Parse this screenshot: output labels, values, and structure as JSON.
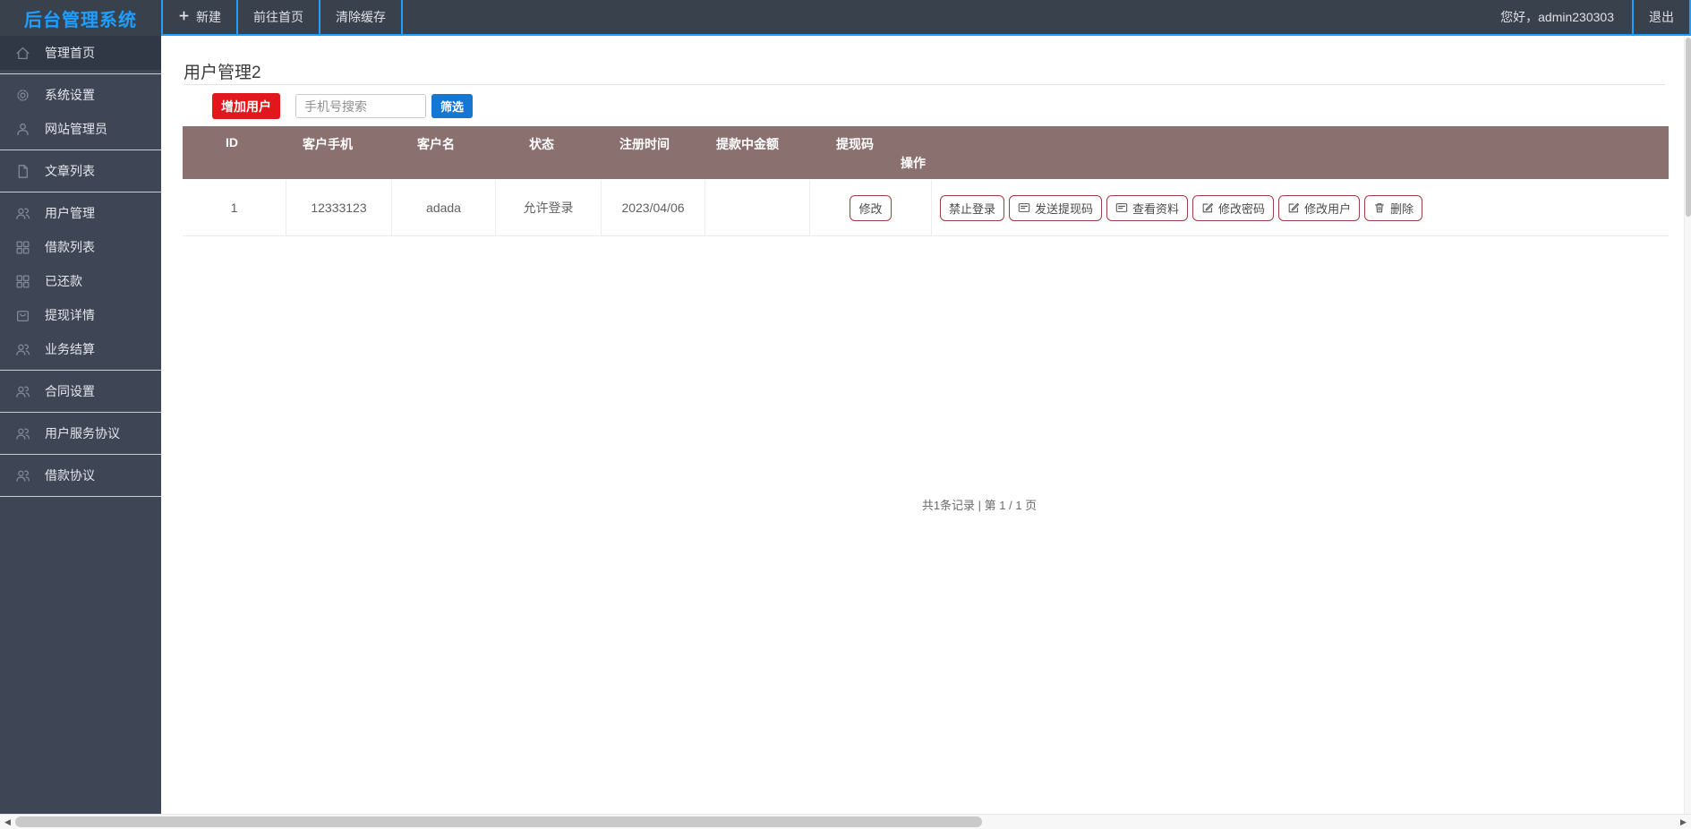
{
  "app_title": "后台管理系统",
  "topbar": {
    "nav": [
      {
        "label": "新建",
        "icon": "plus-icon"
      },
      {
        "label": "前往首页",
        "icon": ""
      },
      {
        "label": "清除缓存",
        "icon": ""
      }
    ],
    "greeting": "您好，admin230303",
    "logout": "退出"
  },
  "sidebar": {
    "items": [
      {
        "label": "管理首页",
        "icon": "home-icon",
        "active": true
      },
      {
        "label": "系统设置",
        "icon": "gear-icon",
        "active": false
      },
      {
        "label": "网站管理员",
        "icon": "user-icon",
        "active": false
      },
      {
        "label": "文章列表",
        "icon": "file-icon",
        "active": false
      },
      {
        "label": "用户管理",
        "icon": "users-icon",
        "active": false
      },
      {
        "label": "借款列表",
        "icon": "grid-icon",
        "active": false
      },
      {
        "label": "已还款",
        "icon": "grid-icon",
        "active": false
      },
      {
        "label": "提现详情",
        "icon": "bag-icon",
        "active": false
      },
      {
        "label": "业务结算",
        "icon": "users-icon",
        "active": false
      },
      {
        "label": "合同设置",
        "icon": "users-icon",
        "active": false
      },
      {
        "label": "用户服务协议",
        "icon": "users-icon",
        "active": false
      },
      {
        "label": "借款协议",
        "icon": "users-icon",
        "active": false
      }
    ]
  },
  "main": {
    "title": "用户管理2",
    "toolbar": {
      "add_user": "增加用户",
      "search_placeholder": "手机号搜索",
      "filter": "筛选"
    },
    "table": {
      "headers": [
        "ID",
        "客户手机",
        "客户名",
        "状态",
        "注册时间",
        "提款中金额",
        "提现码",
        "操作"
      ],
      "rows": [
        {
          "id": "1",
          "phone": "12333123",
          "name": "adada",
          "status": "允许登录",
          "registered": "2023/04/06",
          "withdrawing_amount": "",
          "code_button": "修改",
          "actions": [
            {
              "label": "禁止登录",
              "icon": ""
            },
            {
              "label": "发送提现码",
              "icon": "card-icon"
            },
            {
              "label": "查看资料",
              "icon": "card-icon"
            },
            {
              "label": "修改密码",
              "icon": "edit-icon"
            },
            {
              "label": "修改用户",
              "icon": "edit-icon"
            },
            {
              "label": "删除",
              "icon": "trash-icon"
            }
          ]
        }
      ]
    },
    "pagination": "共1条记录 | 第 1 / 1 页"
  },
  "colors": {
    "accent_blue": "#1e9fff",
    "filter_blue": "#1677d2",
    "danger_red": "#e2171e",
    "table_header": "#8a7170",
    "action_border": "#9e3d3d",
    "sidebar_bg": "#3e4656",
    "topbar_bg": "#39414d"
  }
}
